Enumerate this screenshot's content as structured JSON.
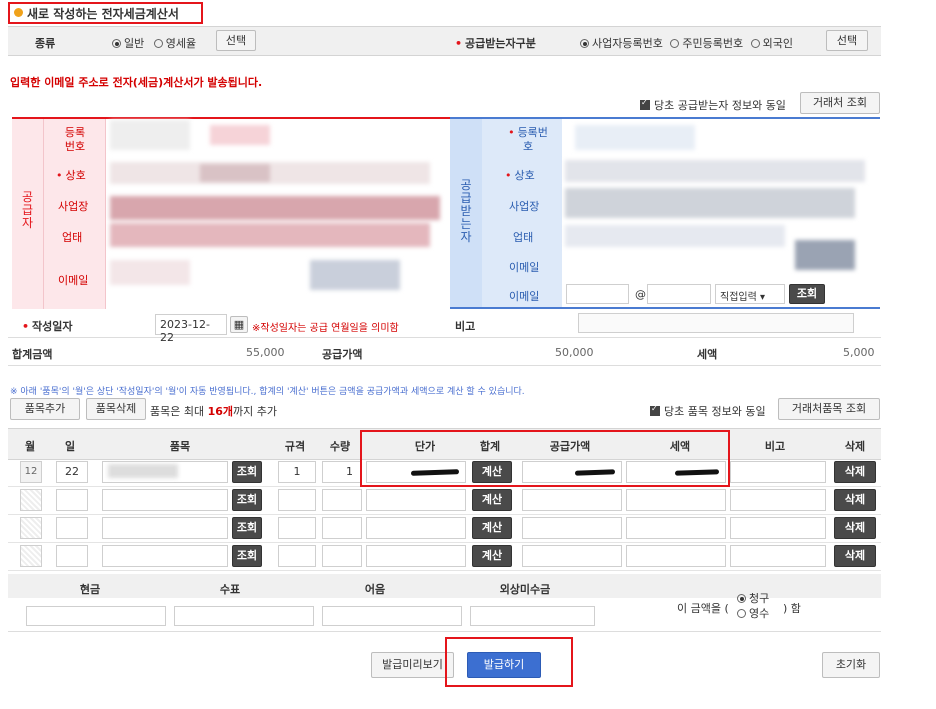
{
  "header": {
    "title": "새로 작성하는 전자세금계산서"
  },
  "type_row": {
    "label": "종류",
    "opt_general": "일반",
    "opt_zero": "영세율",
    "select_btn": "선택",
    "receiver_label": "공급받는자구분",
    "opt_biz": "사업자등록번호",
    "opt_resident": "주민등록번호",
    "opt_foreign": "외국인",
    "select_btn2": "선택"
  },
  "notice": "입력한 이메일 주소로 전자(세금)계산서가 발송됩니다.",
  "agree_receiver": "당초 공급받는자 정보와 동일",
  "partner_lookup": "거래처 조회",
  "supplier": {
    "side": "공급자",
    "reg": "등록번호",
    "name": "상호",
    "addr": "사업장",
    "biz": "업태",
    "email": "이메일"
  },
  "receiver": {
    "side": "공급받는자",
    "reg": "등록번호",
    "name": "상호",
    "addr": "사업장",
    "biz": "업태",
    "email1": "이메일",
    "email2": "이메일",
    "at": "@",
    "direct": "직접입력",
    "lookup": "조회"
  },
  "date_row": {
    "label": "작성일자",
    "date": "2023-12-22",
    "note": "※작성일자는 공급 연월일을 의미함",
    "memo_label": "비고"
  },
  "totals": {
    "sum_label": "합계금액",
    "sum": "55,000",
    "supply_label": "공급가액",
    "supply": "50,000",
    "tax_label": "세액",
    "tax": "5,000"
  },
  "items_notice": "※ 아래 '품목'의 '월'은 상단 '작성일자'의 '월'이 자동 반영됩니다., 합계의 '계산' 버튼은 금액을 공급가액과 세액으로 계산 할 수 있습니다.",
  "items_bar": {
    "add": "품목추가",
    "del": "품목삭제",
    "max_pre": "품목은 최대 ",
    "max_num": "16개",
    "max_post": "까지 추가",
    "agree": "당초 품목 정보와 동일",
    "lookup": "거래처품목 조회"
  },
  "items_header": {
    "month": "월",
    "day": "일",
    "item": "품목",
    "spec": "규격",
    "qty": "수량",
    "price": "단가",
    "sum": "합계",
    "supply": "공급가액",
    "tax": "세액",
    "memo": "비고",
    "delete": "삭제"
  },
  "item_rows": [
    {
      "month": "12",
      "day": "22",
      "spec": "1",
      "qty": "1",
      "lookup": "조회",
      "calc": "계산",
      "delete": "삭제"
    },
    {
      "month": "",
      "day": "",
      "spec": "",
      "qty": "",
      "lookup": "조회",
      "calc": "계산",
      "delete": "삭제"
    },
    {
      "month": "",
      "day": "",
      "spec": "",
      "qty": "",
      "lookup": "조회",
      "calc": "계산",
      "delete": "삭제"
    },
    {
      "month": "",
      "day": "",
      "spec": "",
      "qty": "",
      "lookup": "조회",
      "calc": "계산",
      "delete": "삭제"
    }
  ],
  "payment": {
    "cash": "현금",
    "check": "수표",
    "note": "어음",
    "credit": "외상미수금",
    "amount_pre": "이 금액을 (",
    "claim": "청구",
    "receipt": "영수",
    "amount_post": ") 함"
  },
  "footer": {
    "preview": "발급미리보기",
    "issue": "발급하기",
    "reset": "초기화"
  },
  "colors": {
    "accent_red": "#e4151b",
    "supplier_bg": "#fde7ea",
    "receiver_bg": "#dde9f9",
    "receiver_side": "#cfe0f7"
  }
}
